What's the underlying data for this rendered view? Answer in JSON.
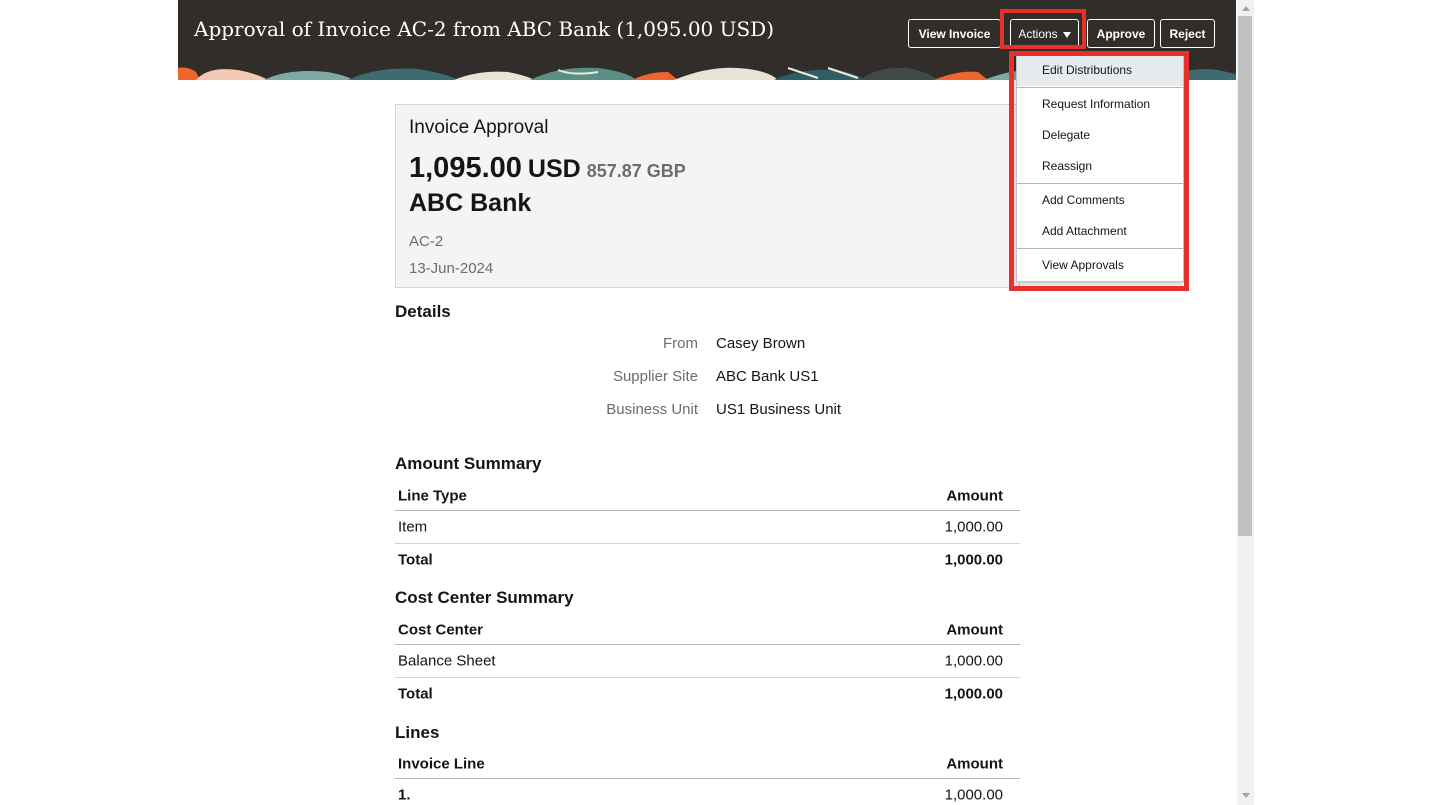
{
  "header": {
    "title": "Approval of Invoice AC-2 from ABC Bank (1,095.00 USD)",
    "buttons": {
      "view_invoice": "View Invoice",
      "actions": "Actions",
      "approve": "Approve",
      "reject": "Reject"
    }
  },
  "actions_menu": {
    "items": [
      "Edit Distributions",
      "Request Information",
      "Delegate",
      "Reassign",
      "Add Comments",
      "Add Attachment",
      "View Approvals"
    ]
  },
  "summary": {
    "title": "Invoice Approval",
    "amount": "1,095.00",
    "currency": "USD",
    "alt_amount": "857.87 GBP",
    "supplier": "ABC Bank",
    "invoice_number": "AC-2",
    "date": "13-Jun-2024"
  },
  "details": {
    "title": "Details",
    "fields": [
      {
        "label": "From",
        "value": "Casey Brown"
      },
      {
        "label": "Supplier Site",
        "value": "ABC Bank US1"
      },
      {
        "label": "Business Unit",
        "value": "US1 Business Unit"
      }
    ]
  },
  "amount_summary": {
    "title": "Amount Summary",
    "columns": [
      "Line Type",
      "Amount"
    ],
    "rows": [
      [
        "Item",
        "1,000.00"
      ]
    ],
    "total": [
      "Total",
      "1,000.00"
    ]
  },
  "cost_center_summary": {
    "title": "Cost Center Summary",
    "columns": [
      "Cost Center",
      "Amount"
    ],
    "rows": [
      [
        "Balance Sheet",
        "1,000.00"
      ]
    ],
    "total": [
      "Total",
      "1,000.00"
    ]
  },
  "lines": {
    "title": "Lines",
    "columns": [
      "Invoice Line",
      "Amount"
    ],
    "rows": [
      [
        "1.",
        "1,000.00"
      ]
    ]
  },
  "colors": {
    "header_bg": "#312d2a",
    "highlight": "#e8302a",
    "menu_active": "#e6ebef"
  },
  "icons": [
    "chevron-down-icon",
    "scroll-up-arrow-icon",
    "scroll-down-arrow-icon"
  ]
}
